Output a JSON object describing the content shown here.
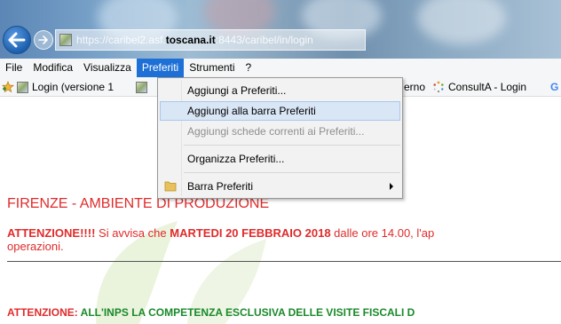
{
  "browser": {
    "url_prefix": "https://",
    "url_sub": "caribel2.asf.",
    "url_host": "toscana.it",
    "url_port": ":8443/",
    "url_path": "caribel/in/login"
  },
  "menubar": {
    "items": [
      "File",
      "Modifica",
      "Visualizza",
      "Preferiti",
      "Strumenti",
      "?"
    ],
    "active_index": 3
  },
  "favbar": {
    "items": [
      "Login (versione 1",
      "erno",
      "ConsultA - Login"
    ],
    "trailing_glyph": "G"
  },
  "dropdown": {
    "items": [
      {
        "label": "Aggiungi a Preferiti...",
        "state": "normal"
      },
      {
        "label": "Aggiungi alla barra Preferiti",
        "state": "hover"
      },
      {
        "label": "Aggiungi schede correnti ai Preferiti...",
        "state": "disabled"
      },
      {
        "label": "Organizza Preferiti...",
        "state": "normal"
      },
      {
        "label": "Barra Preferiti",
        "state": "submenu"
      }
    ]
  },
  "page": {
    "title": "FIRENZE - AMBIENTE DI PRODUZIONE",
    "notice1": {
      "lead": "ATTENZIONE!!!!",
      "text_a": " Si avvisa che ",
      "date": "MARTEDI 20 FEBBRAIO 2018",
      "text_b": " dalle ore 14.00, l'ap",
      "line2": "operazioni."
    },
    "notice2": {
      "lead": "ATTENZIONE:",
      "text": " ALL'INPS LA COMPETENZA ESCLUSIVA DELLE VISITE FISCALI D"
    }
  },
  "colors": {
    "accent_menu": "#1e6fd6",
    "notice_red": "#e02b2b",
    "notice_green": "#1a8a2a"
  }
}
